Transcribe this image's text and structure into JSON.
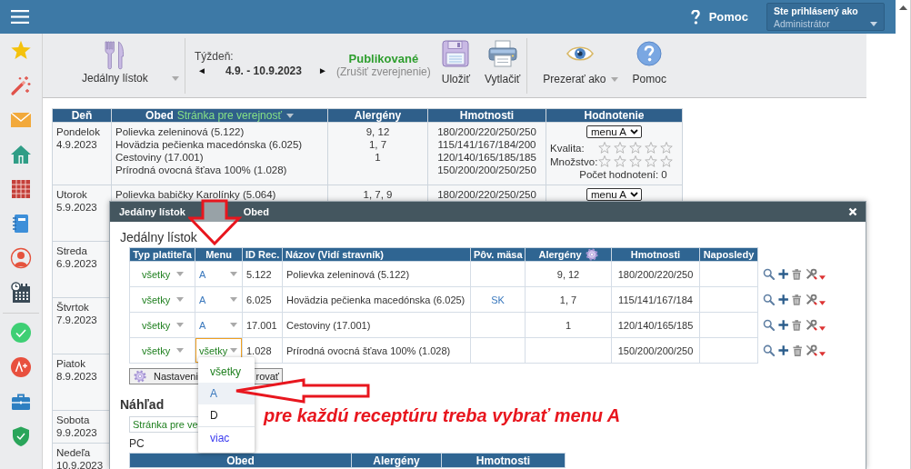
{
  "top_bar": {
    "help_label": "Pomoc",
    "user": {
      "caption": "Ste prihlásený ako",
      "name": "Administrátor"
    }
  },
  "toolbar": {
    "menu_picker": {
      "label": "Jedálny lístok"
    },
    "week": {
      "label": "Týždeň:",
      "prev": "◄",
      "range": "4.9. - 10.9.2023",
      "next": "►"
    },
    "publish": {
      "status": "Publikované",
      "action": "(Zrušiť zverejnenie)"
    },
    "button_groups": [
      [
        {
          "kind": "save",
          "label": "Uložiť",
          "dropdown": false
        },
        {
          "kind": "print",
          "label": "Vytlačiť",
          "dropdown": false
        }
      ],
      [
        {
          "kind": "view_as",
          "label": "Prezerať ako",
          "dropdown": true
        },
        {
          "kind": "help",
          "label": "Pomoc",
          "dropdown": false
        }
      ]
    ]
  },
  "week_table": {
    "columns": [
      {
        "label": "Deň"
      },
      {
        "label": "Obed",
        "filter": "Stránka pre verejnosť"
      },
      {
        "label": "Alergény"
      },
      {
        "label": "Hmotnosti"
      },
      {
        "label": "Hodnotenie"
      }
    ],
    "rows": [
      {
        "day": "Pondelok",
        "date": "4.9.2023",
        "meals": [
          {
            "name": "Polievka zeleninová (5.122)",
            "allergens": "9, 12",
            "weights": "180/200/220/250/250"
          },
          {
            "name": "Hovädzia pečienka macedónska (6.025)",
            "allergens": "1, 7",
            "weights": "115/141/167/184/200"
          },
          {
            "name": "Cestoviny (17.001)",
            "allergens": "1",
            "weights": "120/140/165/185/185"
          },
          {
            "name": "Prírodná ovocná šťava 100% (1.028)",
            "weights": "150/200/200/250/250"
          }
        ],
        "rating": {
          "menu": "menu A",
          "scores": [
            {
              "label": "Kvalita:",
              "stars": 0
            },
            {
              "label": "Množstvo:",
              "stars": 0
            }
          ],
          "count": "Počet hodnotení: 0"
        }
      },
      {
        "day": "Utorok",
        "date": "5.9.2023",
        "meals": [
          {
            "name": "Polievka babičky Karolínky (5.064)",
            "allergens": "1, 7, 9",
            "weights": "180/200/220/250/250"
          }
        ],
        "rating": {
          "menu": "menu A"
        }
      },
      {
        "day": "Streda",
        "date": "6.9.2023"
      },
      {
        "day": "Štvrtok",
        "date": "7.9.2023"
      },
      {
        "day": "Piatok",
        "date": "8.9.2023"
      },
      {
        "day": "Sobota",
        "date": "9.9.2023"
      },
      {
        "day": "Nedeľa",
        "date": "10.9.2023"
      }
    ]
  },
  "modal": {
    "title": "Jedálny lístok",
    "subtitle": "Obed",
    "heading": "Jedálny lístok",
    "table": {
      "columns": [
        {
          "label": "Typ platiteľa"
        },
        {
          "label": "Menu"
        },
        {
          "label": "ID Rec."
        },
        {
          "label": "Názov (Vidí stravník)"
        },
        {
          "label": "Pôv. mäsa"
        },
        {
          "label": "Alergény",
          "settings": true
        },
        {
          "label": "Hmotnosti"
        },
        {
          "label": "Naposledy"
        }
      ],
      "rows": [
        {
          "payer": "všetky",
          "menu": {
            "value": "A",
            "kind": "letter"
          },
          "focused": false,
          "id": "5.122",
          "name": "Polievka zeleninová (5.122)",
          "allergens": "9, 12",
          "weights": "180/200/220/250"
        },
        {
          "payer": "všetky",
          "menu": {
            "value": "A",
            "kind": "letter"
          },
          "focused": false,
          "id": "6.025",
          "name": "Hovädzia pečienka macedónska (6.025)",
          "origin": "SK",
          "allergens": "1, 7",
          "weights": "115/141/167/184"
        },
        {
          "payer": "všetky",
          "menu": {
            "value": "A",
            "kind": "letter"
          },
          "focused": false,
          "id": "17.001",
          "name": "Cestoviny (17.001)",
          "allergens": "1",
          "weights": "120/140/165/185"
        },
        {
          "payer": "všetky",
          "menu": {
            "value": "všetky",
            "kind": "all"
          },
          "focused": true,
          "id": "1.028",
          "name": "Prírodná ovocná šťava 100% (1.028)",
          "weights": "150/200/200/250"
        }
      ]
    },
    "menu_options": [
      {
        "label": "všetky",
        "kind": "all",
        "selected": false
      },
      {
        "label": "A",
        "kind": "letter",
        "selected": true
      },
      {
        "label": "D",
        "kind": "letter",
        "selected": false
      },
      {
        "label": "viac",
        "kind": "more",
        "selected": false
      }
    ],
    "buttons": [
      {
        "kind": "settings",
        "label": "Nastaveni"
      },
      {
        "kind": "plain",
        "label": "rovať"
      }
    ],
    "preview": {
      "heading": "Náhľad",
      "page_select": "Stránka pre ve",
      "device": "PC",
      "columns": [
        {
          "label": "Obed"
        },
        {
          "label": "Alergény"
        },
        {
          "label": "Hmotnosti"
        }
      ]
    }
  },
  "annotation": {
    "note": "pre každú receptúru treba vybrať menu A"
  }
}
